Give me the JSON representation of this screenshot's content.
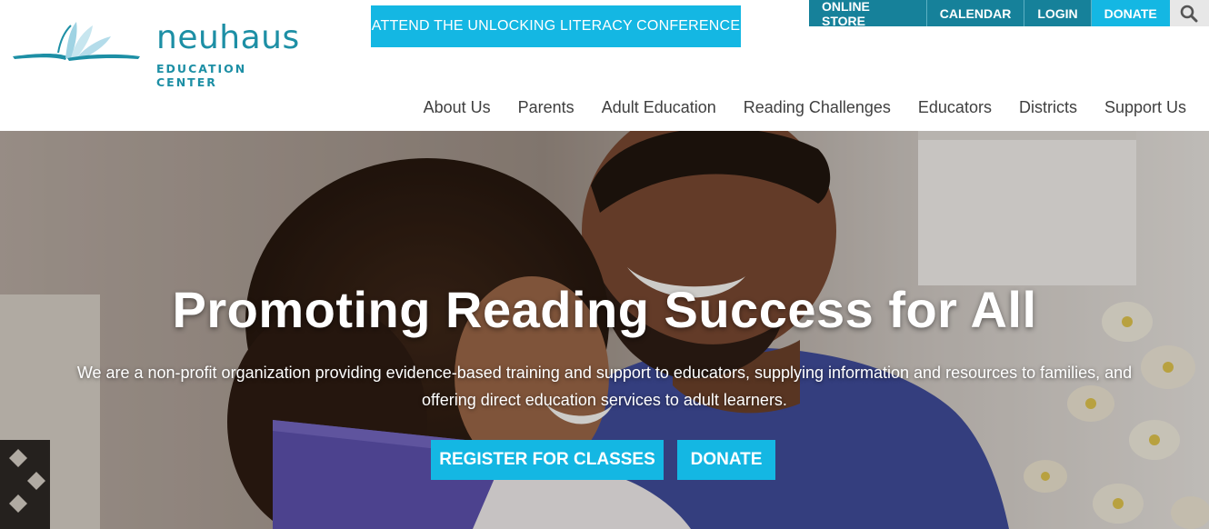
{
  "brand": {
    "name": "neuhaus",
    "subtitle": "EDUCATION CENTER",
    "accent_color": "#1d8fa5"
  },
  "banner": {
    "label": "ATTEND THE UNLOCKING LITERACY CONFERENCE",
    "color": "#14b7e3"
  },
  "utility_nav": {
    "items": [
      "ONLINE STORE",
      "CALENDAR",
      "LOGIN"
    ],
    "donate_label": "DONATE",
    "search_icon": "search-icon",
    "color": "#16819a"
  },
  "main_nav": {
    "items": [
      "About Us",
      "Parents",
      "Adult Education",
      "Reading Challenges",
      "Educators",
      "Districts",
      "Support Us"
    ]
  },
  "hero": {
    "title": "Promoting Reading Success for All",
    "text": "We are a non-profit organization providing evidence-based training and support to educators, supplying information and resources to families, and offering direct education services to adult learners.",
    "register_label": "REGISTER FOR CLASSES",
    "donate_label": "DONATE",
    "photo": "father and daughter reading a book together"
  }
}
